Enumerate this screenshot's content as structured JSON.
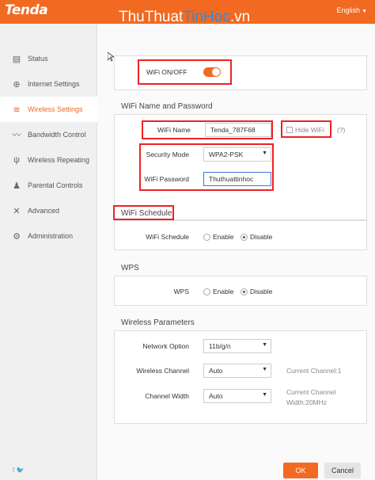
{
  "brand": {
    "logo": "Tenda",
    "watermark_a": "ThuThuat",
    "watermark_b": "TinHoc",
    "watermark_c": ".vn"
  },
  "header": {
    "language": "English",
    "language_caret": "▼"
  },
  "sidebar": {
    "items": [
      {
        "label": "Status",
        "icon": "status-icon",
        "glyph": "▤"
      },
      {
        "label": "Internet Settings",
        "icon": "globe-icon",
        "glyph": "⊕"
      },
      {
        "label": "Wireless Settings",
        "icon": "wifi-icon",
        "glyph": "≋"
      },
      {
        "label": "Bandwidth Control",
        "icon": "chart-icon",
        "glyph": "〰"
      },
      {
        "label": "Wireless Repeating",
        "icon": "antenna-icon",
        "glyph": "ψ"
      },
      {
        "label": "Parental Controls",
        "icon": "parental-icon",
        "glyph": "♟"
      },
      {
        "label": "Advanced",
        "icon": "tools-icon",
        "glyph": "✕"
      },
      {
        "label": "Administration",
        "icon": "gear-icon",
        "glyph": "⚙"
      }
    ],
    "social": "f  🐦"
  },
  "wifi_toggle": {
    "label": "WiFi ON/OFF",
    "state": "on"
  },
  "name_password": {
    "title": "WiFi Name and Password",
    "name_label": "WiFi Name",
    "name_value": "Tenda_787F68",
    "hide_label": "Hide WiFi",
    "help": "(?)",
    "security_label": "Security Mode",
    "security_value": "WPA2-PSK",
    "password_label": "WiFi Password",
    "password_value": "Thuthuattinhoc"
  },
  "schedule": {
    "title": "WiFi Schedule",
    "label": "WiFi Schedule",
    "enable": "Enable",
    "disable": "Disable",
    "selected": "Disable"
  },
  "wps": {
    "title": "WPS",
    "label": "WPS",
    "enable": "Enable",
    "disable": "Disable",
    "selected": "Disable"
  },
  "wireless_params": {
    "title": "Wireless Parameters",
    "network_option_label": "Network Option",
    "network_option_value": "11b/g/n",
    "channel_label": "Wireless Channel",
    "channel_value": "Auto",
    "current_channel": "Current Channel:1",
    "width_label": "Channel Width",
    "width_value": "Auto",
    "current_width_a": "Current Channel",
    "current_width_b": "Width:20MHz"
  },
  "buttons": {
    "ok": "OK",
    "cancel": "Cancel"
  },
  "colors": {
    "accent": "#f26a21",
    "highlight": "#e22222"
  }
}
